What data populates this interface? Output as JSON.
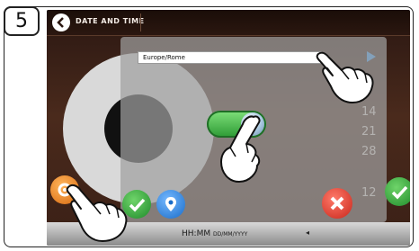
{
  "step": {
    "number": "5"
  },
  "header": {
    "title": "DATE AND TIME"
  },
  "timezone": {
    "value": "Europe/Rome"
  },
  "calendar": {
    "numbers": [
      "14",
      "21",
      "28",
      "12"
    ],
    "orange_label": "n"
  },
  "footer": {
    "time_format": "HH:MM",
    "date_format": "DD/MM/YYYY"
  },
  "colors": {
    "screen_bg": "#3a2016",
    "accent_green": "#2c9a34",
    "accent_blue": "#1a6cc8",
    "accent_red": "#c8261a",
    "accent_orange": "#d86a10",
    "arrow_blue": "#3ba0ff"
  },
  "icons": [
    "back-arrow-icon",
    "dropdown-arrow-icon",
    "checkmark-icon",
    "location-pin-icon",
    "close-x-icon",
    "settings-icon",
    "volume-icon",
    "hand-pointer-icon"
  ],
  "toggle": {
    "state": "on"
  }
}
